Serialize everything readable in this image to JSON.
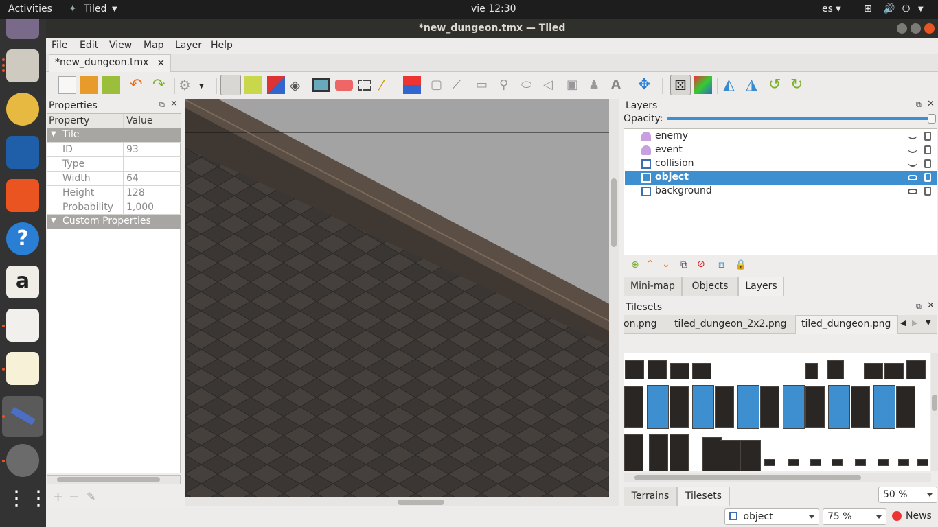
{
  "topbar": {
    "activities": "Activities",
    "app_name": "Tiled",
    "clock": "vie 12:30",
    "lang": "es"
  },
  "window": {
    "title": "*new_dungeon.tmx — Tiled"
  },
  "menu": [
    "File",
    "Edit",
    "View",
    "Map",
    "Layer",
    "Help"
  ],
  "doc_tab": {
    "label": "*new_dungeon.tmx",
    "close": "×"
  },
  "properties": {
    "title": "Properties",
    "col_property": "Property",
    "col_value": "Value",
    "group_tile": "Tile",
    "rows": [
      {
        "k": "ID",
        "v": "93"
      },
      {
        "k": "Type",
        "v": ""
      },
      {
        "k": "Width",
        "v": "64"
      },
      {
        "k": "Height",
        "v": "128"
      },
      {
        "k": "Probability",
        "v": "1,000"
      }
    ],
    "group_custom": "Custom Properties"
  },
  "layers": {
    "title": "Layers",
    "opacity_label": "Opacity:",
    "opacity": 1.0,
    "items": [
      {
        "name": "enemy",
        "type": "object",
        "visible": false
      },
      {
        "name": "event",
        "type": "object",
        "visible": false
      },
      {
        "name": "collision",
        "type": "tile",
        "visible": false
      },
      {
        "name": "object",
        "type": "tile",
        "visible": true,
        "selected": true
      },
      {
        "name": "background",
        "type": "tile",
        "visible": true
      }
    ]
  },
  "dock_tabs": [
    "Mini-map",
    "Objects",
    "Layers"
  ],
  "tilesets": {
    "title": "Tilesets",
    "tabs": [
      "on.png",
      "tiled_dungeon_2x2.png",
      "tiled_dungeon.png"
    ],
    "zoom": "50 %"
  },
  "bottom_tabs": [
    "Terrains",
    "Tilesets"
  ],
  "status": {
    "layer_combo": "object",
    "zoom": "75 %",
    "news": "News"
  },
  "colors": {
    "accent": "#3d8fd0",
    "dock": "#333333",
    "topbar": "#1d1d1d"
  }
}
